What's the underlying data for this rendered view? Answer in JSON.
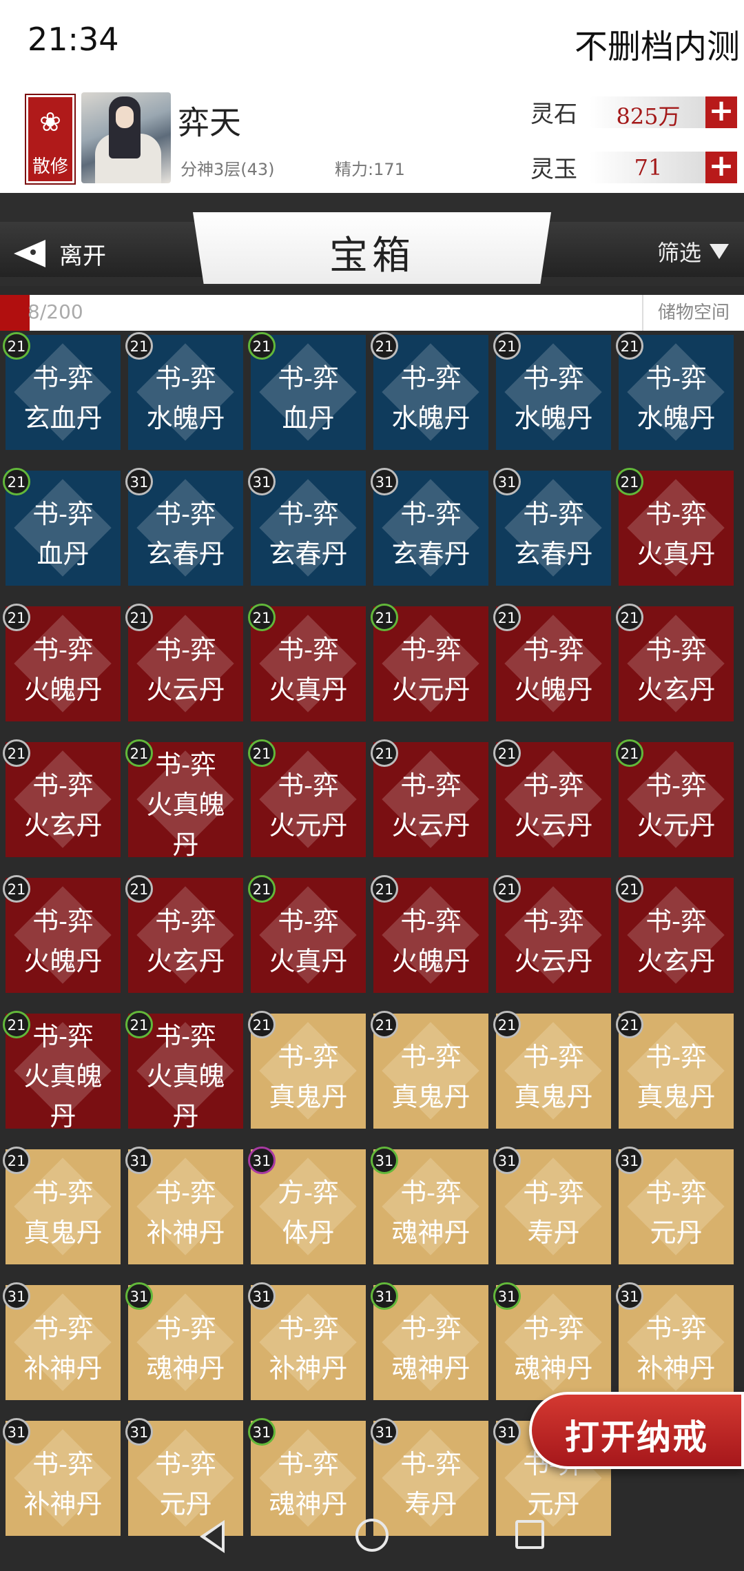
{
  "status": {
    "time": "21:34",
    "build": "不删档内测"
  },
  "profile": {
    "badge": "散修",
    "name": "弈天",
    "realm": "分神3层(43)",
    "energy": "精力:171",
    "lingshi": {
      "label": "灵石",
      "value": "825万"
    },
    "lingyu": {
      "label": "灵玉",
      "value": "71"
    }
  },
  "header": {
    "leave": "离开",
    "title": "宝箱",
    "filter": "筛选"
  },
  "capacity": {
    "text": "8/200",
    "label": "储物空间",
    "fraction": 0.04
  },
  "items": [
    {
      "l1": "书-弈",
      "l2": "玄血丹",
      "lvl": "21",
      "ring": "green",
      "color": "blue"
    },
    {
      "l1": "书-弈",
      "l2": "水魄丹",
      "lvl": "21",
      "ring": "silver",
      "color": "blue"
    },
    {
      "l1": "书-弈",
      "l2": "血丹",
      "lvl": "21",
      "ring": "green",
      "color": "blue"
    },
    {
      "l1": "书-弈",
      "l2": "水魄丹",
      "lvl": "21",
      "ring": "silver",
      "color": "blue"
    },
    {
      "l1": "书-弈",
      "l2": "水魄丹",
      "lvl": "21",
      "ring": "silver",
      "color": "blue"
    },
    {
      "l1": "书-弈",
      "l2": "水魄丹",
      "lvl": "21",
      "ring": "silver",
      "color": "blue"
    },
    {
      "l1": "书-弈",
      "l2": "血丹",
      "lvl": "21",
      "ring": "green",
      "color": "blue"
    },
    {
      "l1": "书-弈",
      "l2": "玄春丹",
      "lvl": "31",
      "ring": "silver",
      "color": "blue"
    },
    {
      "l1": "书-弈",
      "l2": "玄春丹",
      "lvl": "31",
      "ring": "silver",
      "color": "blue"
    },
    {
      "l1": "书-弈",
      "l2": "玄春丹",
      "lvl": "31",
      "ring": "silver",
      "color": "blue"
    },
    {
      "l1": "书-弈",
      "l2": "玄春丹",
      "lvl": "31",
      "ring": "silver",
      "color": "blue"
    },
    {
      "l1": "书-弈",
      "l2": "火真丹",
      "lvl": "21",
      "ring": "green",
      "color": "red"
    },
    {
      "l1": "书-弈",
      "l2": "火魄丹",
      "lvl": "21",
      "ring": "silver",
      "color": "red"
    },
    {
      "l1": "书-弈",
      "l2": "火云丹",
      "lvl": "21",
      "ring": "silver",
      "color": "red"
    },
    {
      "l1": "书-弈",
      "l2": "火真丹",
      "lvl": "21",
      "ring": "green",
      "color": "red"
    },
    {
      "l1": "书-弈",
      "l2": "火元丹",
      "lvl": "21",
      "ring": "green",
      "color": "red"
    },
    {
      "l1": "书-弈",
      "l2": "火魄丹",
      "lvl": "21",
      "ring": "silver",
      "color": "red"
    },
    {
      "l1": "书-弈",
      "l2": "火玄丹",
      "lvl": "21",
      "ring": "silver",
      "color": "red"
    },
    {
      "l1": "书-弈",
      "l2": "火玄丹",
      "lvl": "21",
      "ring": "silver",
      "color": "red"
    },
    {
      "l1": "书-弈",
      "l2": "火真魄",
      "l3": "丹",
      "lvl": "21",
      "ring": "green",
      "color": "red"
    },
    {
      "l1": "书-弈",
      "l2": "火元丹",
      "lvl": "21",
      "ring": "green",
      "color": "red"
    },
    {
      "l1": "书-弈",
      "l2": "火云丹",
      "lvl": "21",
      "ring": "silver",
      "color": "red"
    },
    {
      "l1": "书-弈",
      "l2": "火云丹",
      "lvl": "21",
      "ring": "silver",
      "color": "red"
    },
    {
      "l1": "书-弈",
      "l2": "火元丹",
      "lvl": "21",
      "ring": "green",
      "color": "red"
    },
    {
      "l1": "书-弈",
      "l2": "火魄丹",
      "lvl": "21",
      "ring": "silver",
      "color": "red"
    },
    {
      "l1": "书-弈",
      "l2": "火玄丹",
      "lvl": "21",
      "ring": "silver",
      "color": "red"
    },
    {
      "l1": "书-弈",
      "l2": "火真丹",
      "lvl": "21",
      "ring": "green",
      "color": "red"
    },
    {
      "l1": "书-弈",
      "l2": "火魄丹",
      "lvl": "21",
      "ring": "silver",
      "color": "red"
    },
    {
      "l1": "书-弈",
      "l2": "火云丹",
      "lvl": "21",
      "ring": "silver",
      "color": "red"
    },
    {
      "l1": "书-弈",
      "l2": "火玄丹",
      "lvl": "21",
      "ring": "silver",
      "color": "red"
    },
    {
      "l1": "书-弈",
      "l2": "火真魄",
      "l3": "丹",
      "lvl": "21",
      "ring": "green",
      "color": "red"
    },
    {
      "l1": "书-弈",
      "l2": "火真魄",
      "l3": "丹",
      "lvl": "21",
      "ring": "green",
      "color": "red"
    },
    {
      "l1": "书-弈",
      "l2": "真鬼丹",
      "lvl": "21",
      "ring": "silver",
      "color": "gold"
    },
    {
      "l1": "书-弈",
      "l2": "真鬼丹",
      "lvl": "21",
      "ring": "silver",
      "color": "gold"
    },
    {
      "l1": "书-弈",
      "l2": "真鬼丹",
      "lvl": "21",
      "ring": "silver",
      "color": "gold"
    },
    {
      "l1": "书-弈",
      "l2": "真鬼丹",
      "lvl": "21",
      "ring": "silver",
      "color": "gold"
    },
    {
      "l1": "书-弈",
      "l2": "真鬼丹",
      "lvl": "21",
      "ring": "silver",
      "color": "gold"
    },
    {
      "l1": "书-弈",
      "l2": "补神丹",
      "lvl": "31",
      "ring": "silver",
      "color": "gold"
    },
    {
      "l1": "方-弈",
      "l2": "体丹",
      "lvl": "31",
      "ring": "purple",
      "color": "gold"
    },
    {
      "l1": "书-弈",
      "l2": "魂神丹",
      "lvl": "31",
      "ring": "green",
      "color": "gold"
    },
    {
      "l1": "书-弈",
      "l2": "寿丹",
      "lvl": "31",
      "ring": "silver",
      "color": "gold"
    },
    {
      "l1": "书-弈",
      "l2": "元丹",
      "lvl": "31",
      "ring": "silver",
      "color": "gold"
    },
    {
      "l1": "书-弈",
      "l2": "补神丹",
      "lvl": "31",
      "ring": "silver",
      "color": "gold"
    },
    {
      "l1": "书-弈",
      "l2": "魂神丹",
      "lvl": "31",
      "ring": "green",
      "color": "gold"
    },
    {
      "l1": "书-弈",
      "l2": "补神丹",
      "lvl": "31",
      "ring": "silver",
      "color": "gold"
    },
    {
      "l1": "书-弈",
      "l2": "魂神丹",
      "lvl": "31",
      "ring": "green",
      "color": "gold"
    },
    {
      "l1": "书-弈",
      "l2": "魂神丹",
      "lvl": "31",
      "ring": "green",
      "color": "gold"
    },
    {
      "l1": "书-弈",
      "l2": "补神丹",
      "lvl": "31",
      "ring": "silver",
      "color": "gold"
    },
    {
      "l1": "书-弈",
      "l2": "补神丹",
      "lvl": "31",
      "ring": "silver",
      "color": "gold"
    },
    {
      "l1": "书-弈",
      "l2": "元丹",
      "lvl": "31",
      "ring": "silver",
      "color": "gold"
    },
    {
      "l1": "书-弈",
      "l2": "魂神丹",
      "lvl": "31",
      "ring": "green",
      "color": "gold"
    },
    {
      "l1": "书-弈",
      "l2": "寿丹",
      "lvl": "31",
      "ring": "silver",
      "color": "gold"
    },
    {
      "l1": "书-弈",
      "l2": "元丹",
      "lvl": "31",
      "ring": "silver",
      "color": "gold"
    }
  ],
  "open_button": "打开纳戒",
  "nav": {
    "back_icon": "back-triangle-icon",
    "home_icon": "home-circle-icon",
    "recent_icon": "recent-square-icon"
  }
}
